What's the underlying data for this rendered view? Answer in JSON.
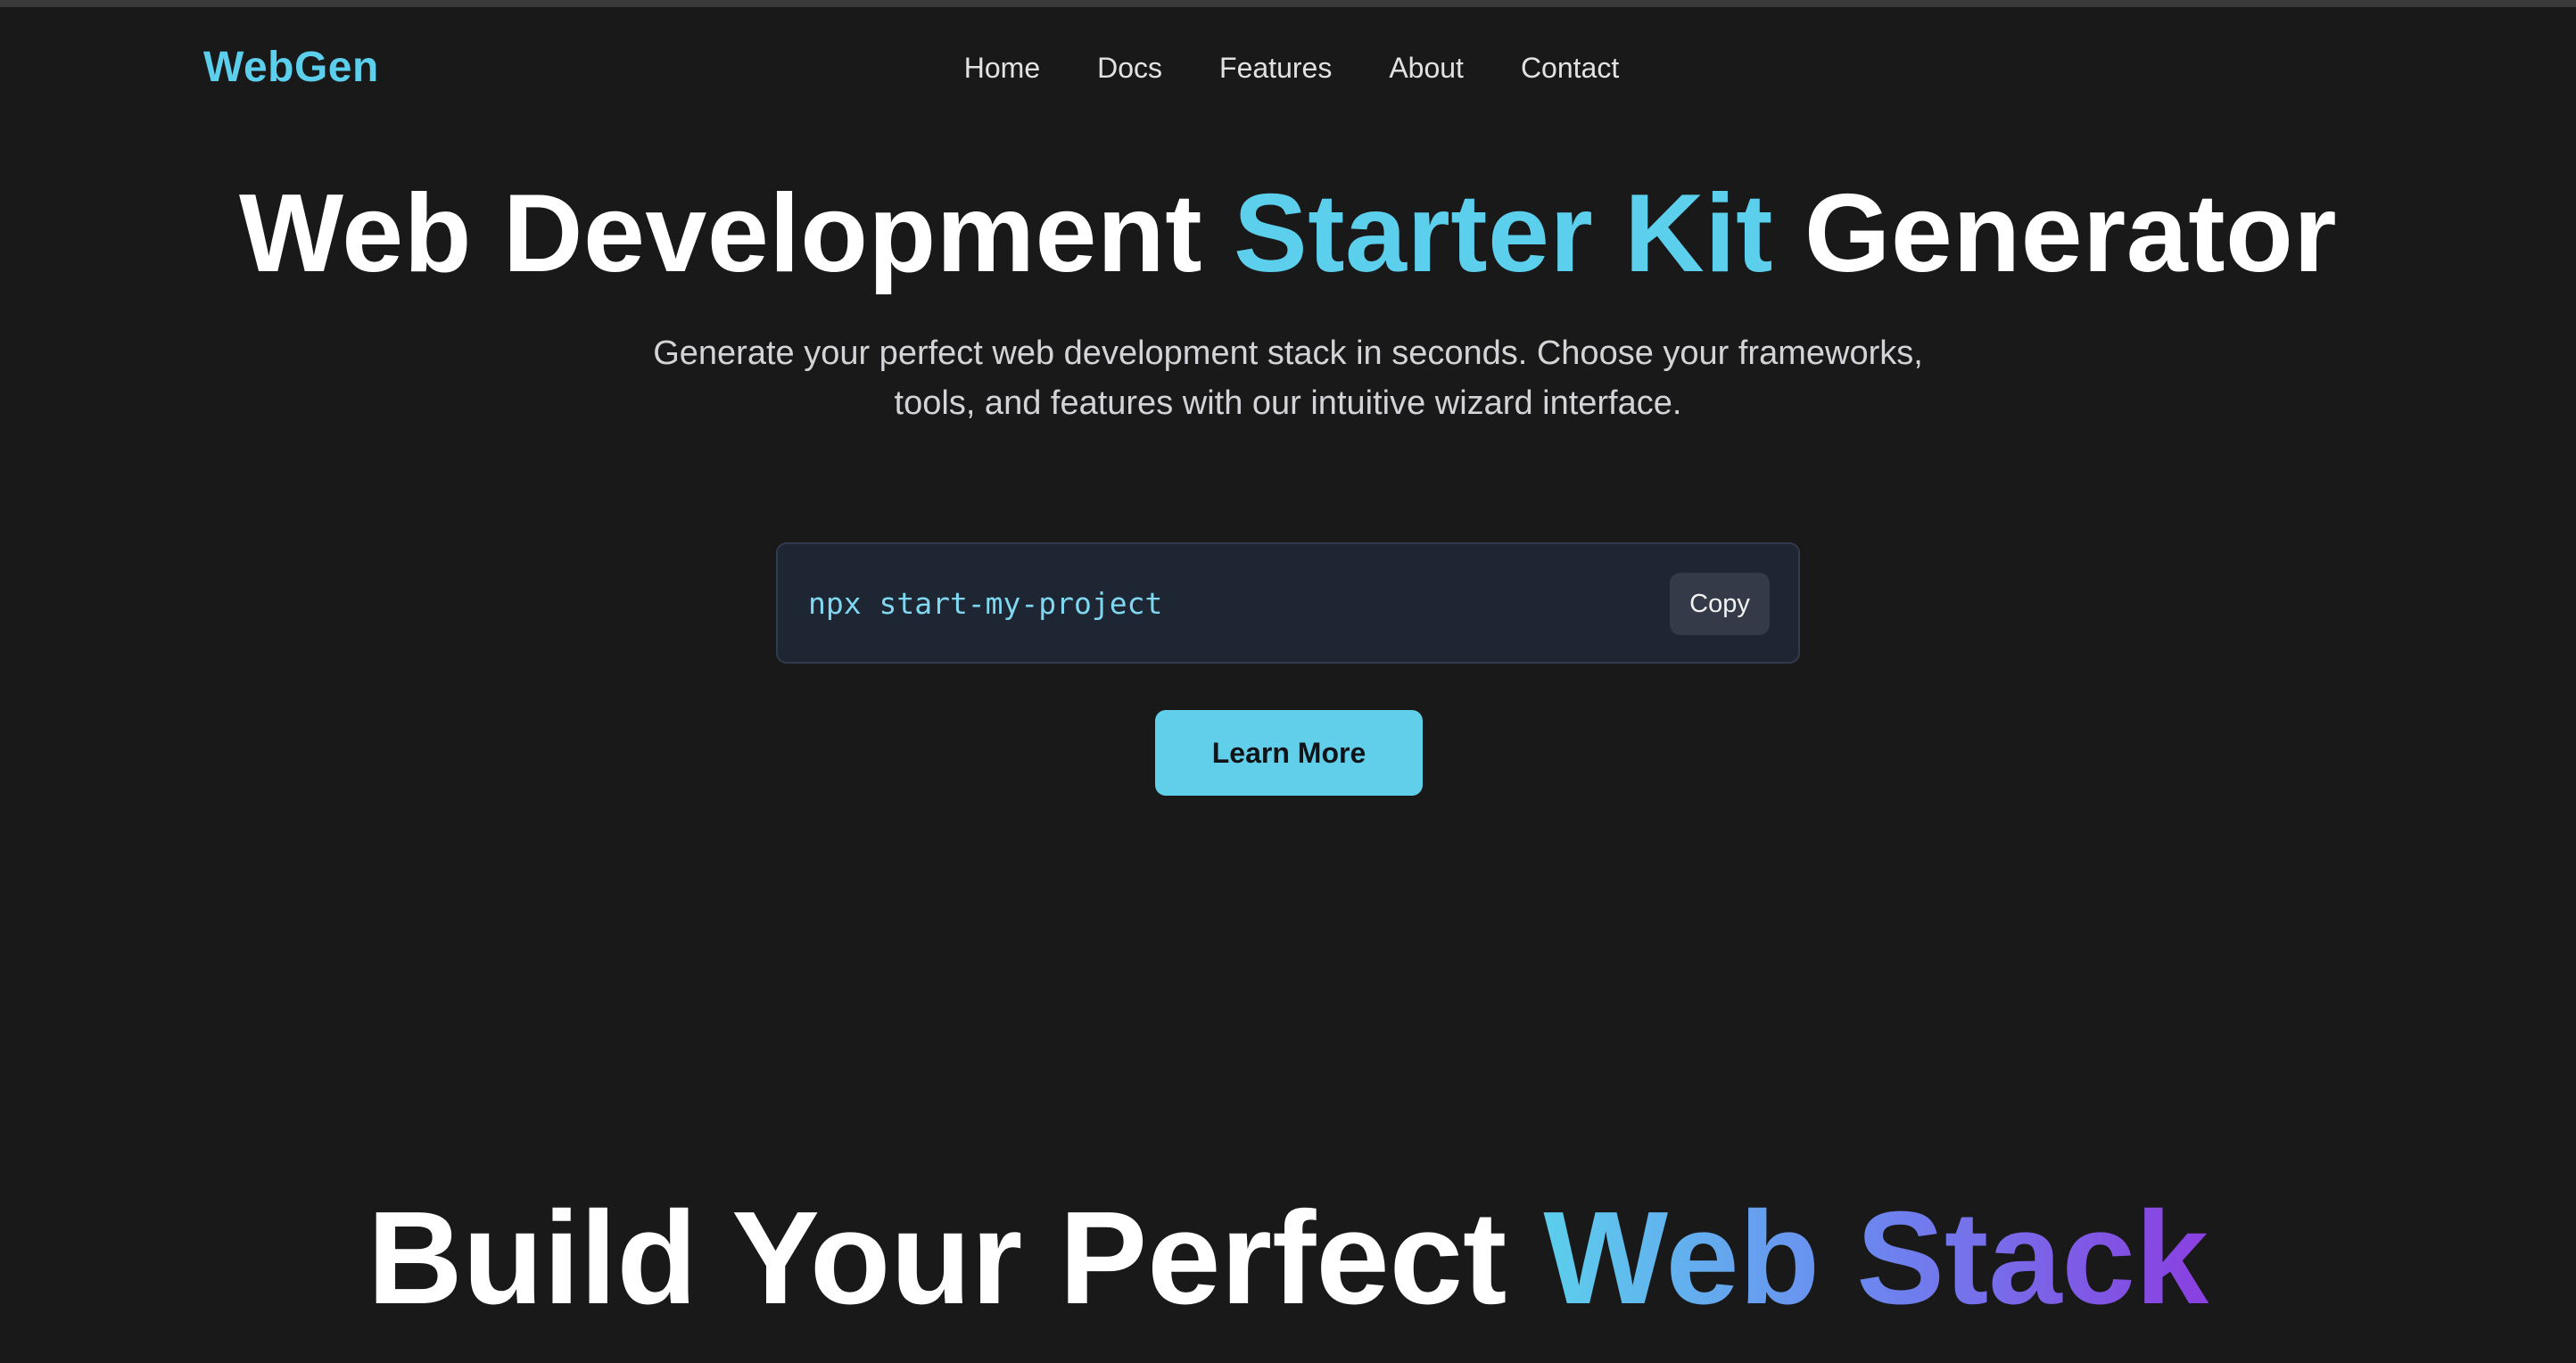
{
  "brand": {
    "name": "WebGen",
    "accent_color": "#5ccfec"
  },
  "nav": {
    "items": [
      {
        "label": "Home"
      },
      {
        "label": "Docs"
      },
      {
        "label": "Features"
      },
      {
        "label": "About"
      },
      {
        "label": "Contact"
      }
    ]
  },
  "hero": {
    "title_start": "Web Development ",
    "title_accent": "Starter Kit",
    "title_end": " Generator",
    "subtitle_line1": "Generate your perfect web development stack in seconds. Choose your frameworks,",
    "subtitle_line2": "tools, and features with our intuitive wizard interface."
  },
  "command": {
    "text": "npx start-my-project",
    "copy_label": "Copy"
  },
  "cta": {
    "learn_more_label": "Learn More",
    "button_color": "#62cfea"
  },
  "section": {
    "title_start": "Build Your Perfect ",
    "title_gradient": "Web Stack",
    "gradient_colors": [
      "#5ccfec",
      "#6a8cf0",
      "#8a3fe0"
    ]
  },
  "colors": {
    "background": "#191919",
    "command_bg": "#1e2533"
  }
}
